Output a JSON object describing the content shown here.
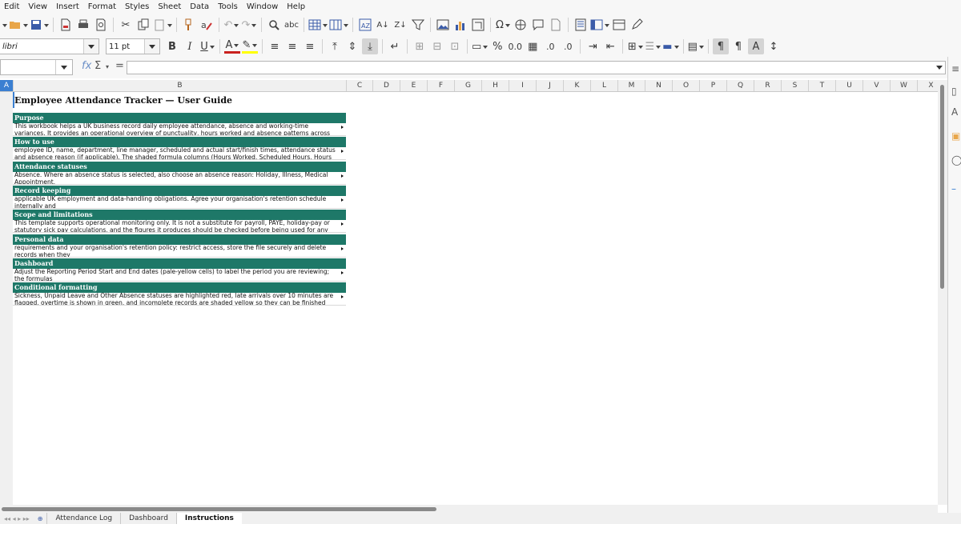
{
  "menu": [
    "Edit",
    "View",
    "Insert",
    "Format",
    "Styles",
    "Sheet",
    "Data",
    "Tools",
    "Window",
    "Help"
  ],
  "font": {
    "name": "libri",
    "size": "11 pt"
  },
  "formula": {
    "namebox": "",
    "content": ""
  },
  "columns": [
    "A",
    "B",
    "C",
    "D",
    "E",
    "F",
    "G",
    "H",
    "I",
    "J",
    "K",
    "L",
    "M",
    "N",
    "O",
    "P",
    "Q",
    "R",
    "S",
    "T",
    "U",
    "V",
    "W",
    "X"
  ],
  "selected_column": "A",
  "guide": {
    "title": "Employee Attendance Tracker — User Guide",
    "sections": [
      {
        "heading": "Purpose",
        "body": "This workbook helps a UK business record daily employee attendance, absence and working-time variances. It provides an operational overview of punctuality, hours worked and absence patterns across teams."
      },
      {
        "heading": "How to use",
        "body": "employee ID, name, department, line manager, scheduled and actual start/finish times, attendance status and absence reason (if applicable). The shaded formula columns (Hours Worked, Scheduled Hours, Hours Variance, Late Minutes"
      },
      {
        "heading": "Attendance statuses",
        "body": "Absence. Where an absence status is selected, also choose an absence reason: Holiday, Illness, Medical Appointment,"
      },
      {
        "heading": "Record keeping",
        "body": "applicable UK employment and data-handling obligations. Agree your organisation's retention schedule internally and"
      },
      {
        "heading": "Scope and limitations",
        "body": "This template supports operational monitoring only. It is not a substitute for payroll, PAYE, holiday-pay or statutory sick pay calculations, and the figures it produces should be checked before being used for any pay decision."
      },
      {
        "heading": "Personal data",
        "body": "requirements and your organisation's retention policy: restrict access, store the file securely and delete records when they"
      },
      {
        "heading": "Dashboard",
        "body": "Adjust the Reporting Period Start and End dates (pale-yellow cells) to label the period you are reviewing; the formulas"
      },
      {
        "heading": "Conditional formatting",
        "body": "Sickness, Unpaid Leave and Other Absence statuses are highlighted red, late arrivals over 10 minutes are flagged, overtime is shown in green, and incomplete records are shaded yellow so they can be finished promptly."
      }
    ]
  },
  "tabs": [
    "Attendance Log",
    "Dashboard",
    "Instructions"
  ],
  "active_tab": "Instructions"
}
